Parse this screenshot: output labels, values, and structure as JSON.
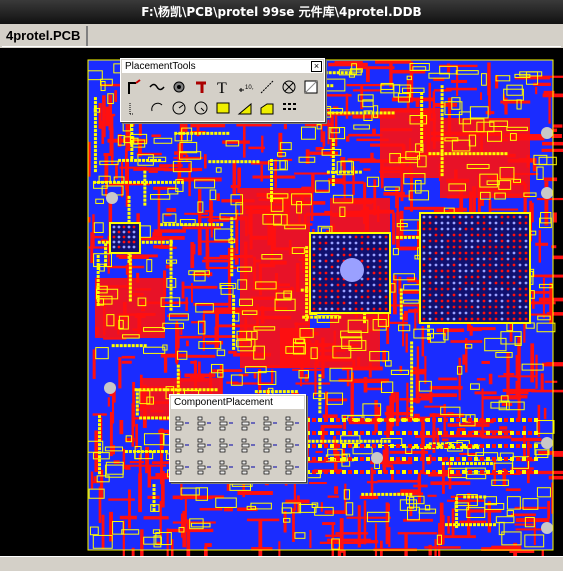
{
  "window": {
    "title": "F:\\杨凯\\PCB\\protel 99se 元件库\\4protel.DDB"
  },
  "document_tab": {
    "label": "4protel.PCB"
  },
  "placement_tools": {
    "title": "PlacementTools",
    "close": "×",
    "tools": [
      "interactive-route-icon",
      "wire-icon",
      "via-icon",
      "pin-tool-icon",
      "text-icon",
      "coordinate-icon",
      "dimension-icon",
      "origin-icon",
      "board-outline-icon",
      "corner-arc-icon",
      "center-arc-icon",
      "arc-edge-icon",
      "full-circle-icon",
      "fill-icon",
      "polygon-plane-icon",
      "split-plane-icon",
      "array-paste-icon"
    ],
    "text_tool_glyph": "T",
    "coordinate_glyph": "10,10"
  },
  "component_placement": {
    "title": "ComponentPlacement",
    "close": "×",
    "tools": [
      "align-left-icon",
      "align-center-horizontal-icon",
      "align-right-icon",
      "space-horizontal-equal-icon",
      "increase-horizontal-space-icon",
      "decrease-horizontal-space-icon",
      "align-top-icon",
      "align-center-vertical-icon",
      "align-bottom-icon",
      "space-vertical-equal-icon",
      "increase-vertical-space-icon",
      "decrease-vertical-space-icon",
      "room-align-icon",
      "group-align-icon",
      "move-to-grid-icon",
      "arrange-in-room-icon",
      "arrange-outside-icon",
      "snap-to-grid-icon"
    ]
  },
  "colors": {
    "background": "#000000",
    "top_layer": "#ff1010",
    "bottom_layer": "#1a2cff",
    "silkscreen": "#ffff00",
    "pads": "#c8c8c8",
    "ui_face": "#d4d0c8"
  }
}
